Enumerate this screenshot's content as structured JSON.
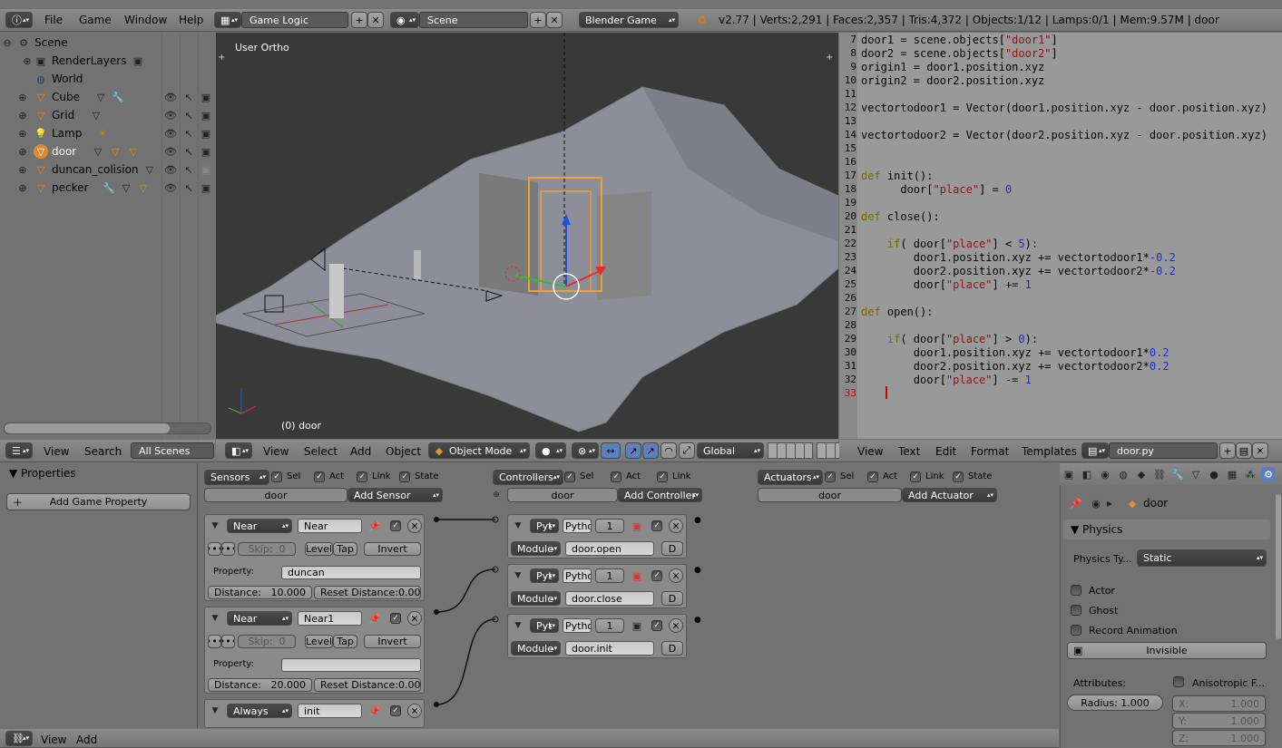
{
  "topbar": {
    "menus": [
      "File",
      "Game",
      "Window",
      "Help"
    ],
    "layout": "Game Logic",
    "scene": "Scene",
    "engine": "Blender Game",
    "stats": "v2.77 | Verts:2,291 | Faces:2,357 | Tris:4,372 | Objects:1/12 | Lamps:0/1 | Mem:9.57M | door"
  },
  "outliner": {
    "items": [
      {
        "label": "Scene",
        "icon": "scene-icon"
      },
      {
        "label": "RenderLayers",
        "icon": "renderlayers-icon"
      },
      {
        "label": "World",
        "icon": "world-icon"
      },
      {
        "label": "Cube",
        "icon": "mesh-icon"
      },
      {
        "label": "Grid",
        "icon": "mesh-icon"
      },
      {
        "label": "Lamp",
        "icon": "lamp-icon"
      },
      {
        "label": "door",
        "icon": "mesh-icon"
      },
      {
        "label": "duncan_colision",
        "icon": "mesh-icon"
      },
      {
        "label": "pecker",
        "icon": "mesh-icon"
      }
    ],
    "footer": {
      "view": "View",
      "search": "Search",
      "filter": "All Scenes"
    }
  },
  "viewport": {
    "label": "User Ortho",
    "object_label": "(0) door",
    "menus": [
      "View",
      "Select",
      "Add",
      "Object"
    ],
    "mode": "Object Mode",
    "orientation": "Global"
  },
  "text_editor": {
    "lines": [
      {
        "n": "7",
        "code": "door1 = scene.objects[\"door1\"]"
      },
      {
        "n": "8",
        "code": "door2 = scene.objects[\"door2\"]"
      },
      {
        "n": "9",
        "code": "origin1 = door1.position.xyz"
      },
      {
        "n": "10",
        "code": "origin2 = door2.position.xyz"
      },
      {
        "n": "11",
        "code": ""
      },
      {
        "n": "12",
        "code": "vectortodoor1 = Vector(door1.position.xyz - door.position.xyz)"
      },
      {
        "n": "13",
        "code": ""
      },
      {
        "n": "14",
        "code": "vectortodoor2 = Vector(door2.position.xyz - door.position.xyz)"
      },
      {
        "n": "15",
        "code": ""
      },
      {
        "n": "16",
        "code": ""
      },
      {
        "n": "17",
        "code": "def init():"
      },
      {
        "n": "18",
        "code": "      door[\"place\"] = 0"
      },
      {
        "n": "19",
        "code": ""
      },
      {
        "n": "20",
        "code": "def close():"
      },
      {
        "n": "21",
        "code": ""
      },
      {
        "n": "22",
        "code": "    if( door[\"place\"] < 5):"
      },
      {
        "n": "23",
        "code": "        door1.position.xyz += vectortodoor1*-0.2"
      },
      {
        "n": "24",
        "code": "        door2.position.xyz += vectortodoor2*-0.2"
      },
      {
        "n": "25",
        "code": "        door[\"place\"] += 1"
      },
      {
        "n": "26",
        "code": ""
      },
      {
        "n": "27",
        "code": "def open():"
      },
      {
        "n": "28",
        "code": ""
      },
      {
        "n": "29",
        "code": "    if( door[\"place\"] > 0):"
      },
      {
        "n": "30",
        "code": "        door1.position.xyz += vectortodoor1*0.2"
      },
      {
        "n": "31",
        "code": "        door2.position.xyz += vectortodoor2*0.2"
      },
      {
        "n": "32",
        "code": "        door[\"place\"] -= 1"
      },
      {
        "n": "33",
        "code": ""
      }
    ],
    "menus": [
      "View",
      "Text",
      "Edit",
      "Format",
      "Templates"
    ],
    "filename": "door.py"
  },
  "properties_panel": {
    "title": "Properties",
    "add_game_property": "Add Game Property"
  },
  "logic": {
    "sensors_label": "Sensors",
    "controllers_label": "Controllers",
    "actuators_label": "Actuators",
    "sel": "Sel",
    "act": "Act",
    "link": "Link",
    "state": "State",
    "object": "door",
    "add_sensor": "Add Sensor",
    "add_controller": "Add Controller",
    "add_actuator": "Add Actuator",
    "sensors": [
      {
        "type": "Near",
        "name": "Near",
        "skip": "Skip:",
        "skip_val": "0",
        "level": "Level",
        "tap": "Tap",
        "invert": "Invert",
        "property_label": "Property:",
        "property": "duncan",
        "distance_label": "Distance:",
        "distance": "10.000",
        "reset_label": "Reset Distance:",
        "reset": "0.000"
      },
      {
        "type": "Near",
        "name": "Near1",
        "skip": "Skip:",
        "skip_val": "0",
        "level": "Level",
        "tap": "Tap",
        "invert": "Invert",
        "property_label": "Property:",
        "property": "",
        "distance_label": "Distance:",
        "distance": "20.000",
        "reset_label": "Reset Distance:",
        "reset": "0.000"
      },
      {
        "type": "Always",
        "name": "init"
      }
    ],
    "controllers": [
      {
        "type": "Pyt",
        "name": "Pytho",
        "state": "1",
        "mode": "Module",
        "module": "door.open",
        "d": "D"
      },
      {
        "type": "Pyt",
        "name": "Pytho",
        "state": "1",
        "mode": "Module",
        "module": "door.close",
        "d": "D"
      },
      {
        "type": "Pyt",
        "name": "Pytho",
        "state": "1",
        "mode": "Module",
        "module": "door.init",
        "d": "D"
      }
    ]
  },
  "physics": {
    "object": "door",
    "section": "Physics",
    "type_label": "Physics Ty...",
    "type": "Static",
    "actor": "Actor",
    "ghost": "Ghost",
    "record": "Record Animation",
    "invisible": "Invisible",
    "attributes": "Attributes:",
    "anisotropic": "Anisotropic F...",
    "radius_label": "Radius:",
    "radius": "1.000",
    "x_label": "X:",
    "x": "1.000",
    "y_label": "Y:",
    "y": "1.000",
    "z_label": "Z:",
    "z": "1.000"
  },
  "bottombar": {
    "menus": [
      "View",
      "Add"
    ]
  }
}
